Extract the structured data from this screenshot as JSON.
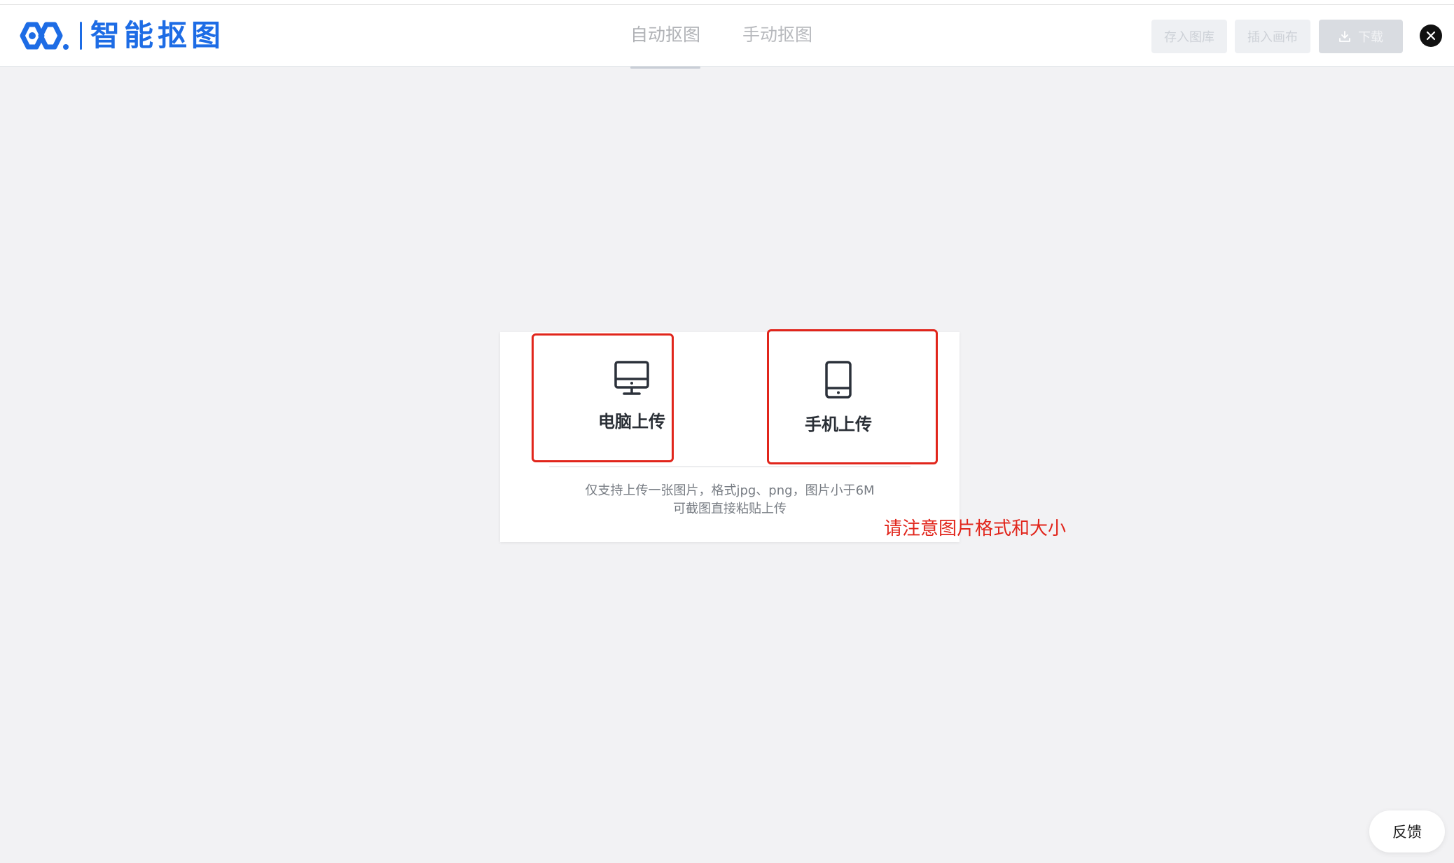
{
  "header": {
    "brand_title": "智能抠图",
    "brand_color": "#1d6ce5",
    "tabs": [
      {
        "label": "自动抠图",
        "active": true
      },
      {
        "label": "手动抠图",
        "active": false
      }
    ],
    "toolbar": {
      "save_label": "存入图库",
      "insert_label": "插入画布",
      "download_label": "下载"
    },
    "close_icon": "close-icon"
  },
  "upload": {
    "pc_label": "电脑上传",
    "pc_icon": "desktop-icon",
    "mobile_label": "手机上传",
    "mobile_icon": "tablet-icon",
    "hint_line1": "仅支持上传一张图片，格式jpg、png，图片小于6M",
    "hint_line2": "可截图直接粘贴上传"
  },
  "annotation": {
    "note": "请注意图片格式和大小",
    "color": "#e1251b"
  },
  "feedback_label": "反馈"
}
